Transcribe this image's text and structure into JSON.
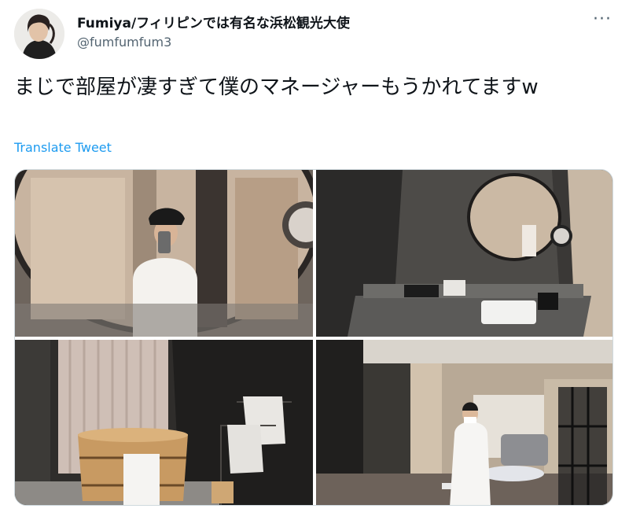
{
  "tweet": {
    "author_name": "Fumiya/フィリピンでは有名な浜松観光大使",
    "author_handle": "@fumfumfum3",
    "more_icon": "more-horizontal-icon",
    "text": "まじで部屋が凄すぎて僕のマネージャーもうかれてますw",
    "translate_label": "Translate Tweet"
  },
  "colors": {
    "link": "#1d9bf0",
    "text": "#0f1419",
    "secondary": "#536471"
  },
  "photos": [
    "mirror-selfie-photo",
    "bathroom-vanity-photo",
    "wooden-bathtub-photo",
    "room-overview-photo"
  ]
}
